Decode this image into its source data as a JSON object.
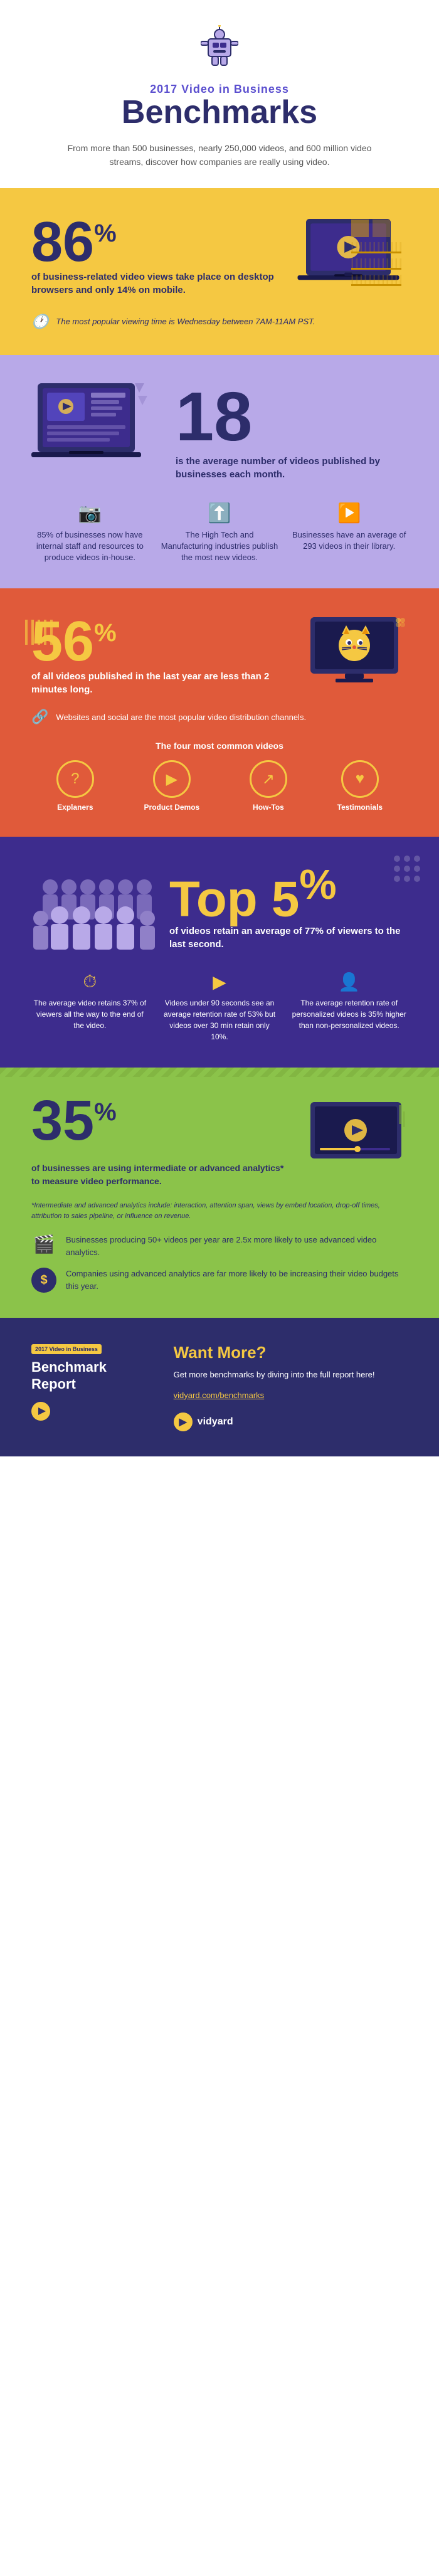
{
  "header": {
    "robot_icon": "🤖",
    "brand": "2017 Video in Business",
    "title": "Benchmarks",
    "description": "From more than 500 businesses, nearly 250,000 videos, and 600 million video streams, discover how companies are really using video."
  },
  "section_yellow": {
    "stat": "86",
    "sup": "%",
    "description": "of business-related video views take place on desktop browsers and only 14% on mobile.",
    "footer_note": "The most popular viewing time is Wednesday between 7AM-11AM PST."
  },
  "section_purple": {
    "number": "18",
    "description": "is the average number of videos published by businesses each month.",
    "stats": [
      {
        "icon": "📷",
        "text": "85% of businesses now have internal staff and resources to produce videos in-house."
      },
      {
        "icon": "⬆️",
        "text": "The High Tech and Manufacturing industries publish the most new videos."
      },
      {
        "icon": "▶️",
        "text": "Businesses have an average of 293 videos in their library."
      }
    ]
  },
  "section_orange": {
    "stat": "56",
    "sup": "%",
    "description": "of all videos published in the last year are less than 2 minutes long.",
    "footer_note": "Websites and social are the most popular video distribution channels.",
    "four_videos_title": "The four most common videos",
    "video_types": [
      {
        "icon": "?",
        "label": "Explaners"
      },
      {
        "icon": "▶",
        "label": "Product Demos"
      },
      {
        "icon": "↗",
        "label": "How-Tos"
      },
      {
        "icon": "♥",
        "label": "Testimonials"
      }
    ]
  },
  "section_dark_purple": {
    "stat": "Top 5",
    "sup": "%",
    "description": "of videos retain an average of 77% of viewers to the last second.",
    "stats": [
      {
        "icon": "⏱",
        "text": "The average video retains 37% of viewers all the way to the end of the video."
      },
      {
        "icon": "▶",
        "text": "Videos under 90 seconds see an average retention rate of 53% but videos over 30 min retain only 10%."
      },
      {
        "icon": "👤",
        "text": "The average retention rate of personalized videos is 35% higher than non-personalized videos."
      }
    ]
  },
  "section_green": {
    "stat": "35",
    "sup": "%",
    "description": "of businesses are using intermediate or advanced analytics* to measure video performance.",
    "footnote": "*Intermediate and advanced analytics include: interaction, attention span, views by embed location, drop-off times, attribution to sales pipeline, or influence on revenue.",
    "bottom_items": [
      {
        "icon": "🎬",
        "text": "Businesses producing 50+ videos per year are 2.5x more likely to use advanced video analytics."
      },
      {
        "icon": "$",
        "text": "Companies using advanced analytics are far more likely to be increasing their video budgets this year.",
        "is_dollar": true
      }
    ]
  },
  "section_footer": {
    "badge": "2017 Video in Business",
    "report_title": "Benchmark\nReport",
    "want_more": "Want More?",
    "description": "Get more benchmarks by diving into the full report here!",
    "link": "vidyard.com/benchmarks",
    "logo_text": "vidyard"
  }
}
